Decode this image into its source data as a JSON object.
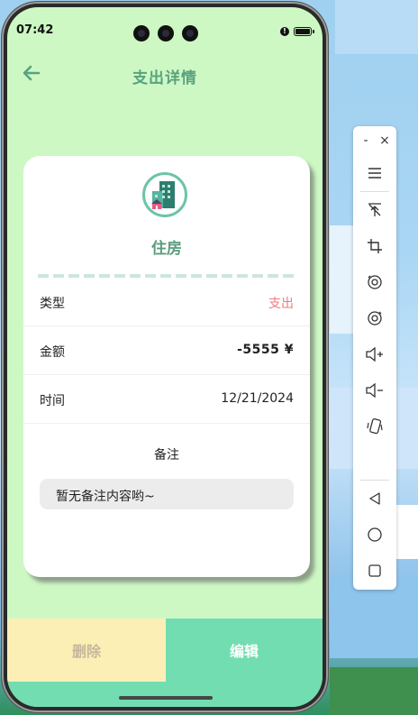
{
  "status_bar": {
    "time": "07:42"
  },
  "header": {
    "title": "支出详情"
  },
  "category": {
    "name": "住房",
    "icon": "building-icon"
  },
  "details": [
    {
      "label": "类型",
      "value": "支出"
    },
    {
      "label": "金额",
      "value": "-5555 ¥"
    },
    {
      "label": "时间",
      "value": "12/21/2024"
    }
  ],
  "remark": {
    "title": "备注",
    "text": "暂无备注内容哟~"
  },
  "actions": {
    "delete_label": "删除",
    "edit_label": "编辑"
  },
  "colors": {
    "background": "#cdf8c4",
    "title": "#58a27e",
    "expense": "#ef7b7b",
    "delete_bg": "#fcefb5",
    "edit_bg": "#72ddb1"
  },
  "toolbar": {
    "minimize_label": "-",
    "close_label": "×",
    "tools": [
      "menu-icon",
      "pin-icon",
      "crop-icon",
      "rotate-left-icon",
      "rotate-right-icon",
      "volume-up-icon",
      "volume-down-icon",
      "shake-icon",
      "back-icon",
      "home-icon",
      "overview-icon"
    ]
  }
}
